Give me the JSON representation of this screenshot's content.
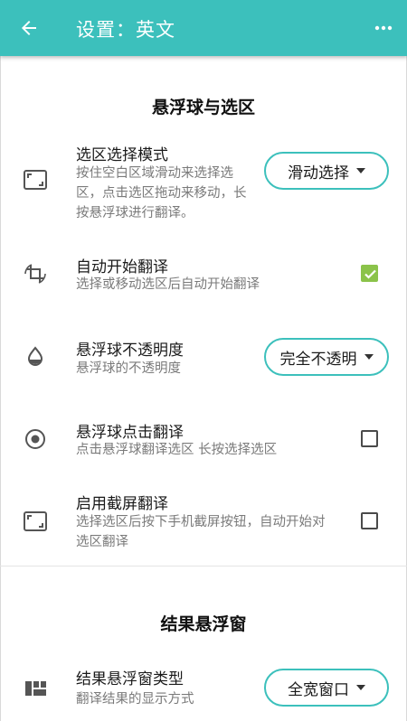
{
  "appbar": {
    "title": "设置：英文",
    "back_icon": "arrow-left-icon",
    "more_icon": "more-horizontal-icon",
    "color": "#3cc0bc"
  },
  "sections": {
    "float": {
      "title": "悬浮球与选区"
    },
    "result": {
      "title": "结果悬浮窗"
    }
  },
  "rows": {
    "select_mode": {
      "title": "选区选择模式",
      "desc": "按住空白区域滑动来选择选区，点击选区拖动来移动，长按悬浮球进行翻译。",
      "icon": "aspect-ratio-icon",
      "dropdown": "滑动选择"
    },
    "auto_translate": {
      "title": "自动开始翻译",
      "desc": "选择或移动选区后自动开始翻译",
      "icon": "crop-rotate-icon",
      "checked": true
    },
    "opacity": {
      "title": "悬浮球不透明度",
      "desc": "悬浮球的不透明度",
      "icon": "opacity-drop-icon",
      "dropdown": "完全不透明"
    },
    "tap_translate": {
      "title": "悬浮球点击翻译",
      "desc": "点击悬浮球翻译选区 长按选择选区",
      "icon": "radio-button-icon",
      "checked": false
    },
    "screenshot_translate": {
      "title": "启用截屏翻译",
      "desc": "选择选区后按下手机截屏按钮，自动开始对选区翻译",
      "icon": "aspect-ratio-icon",
      "checked": false
    },
    "result_type": {
      "title": "结果悬浮窗类型",
      "desc": "翻译结果的显示方式",
      "icon": "view-quilt-icon",
      "dropdown": "全宽窗口"
    }
  },
  "colors": {
    "accent": "#3cc0bc",
    "checked": "#8bc34a"
  }
}
